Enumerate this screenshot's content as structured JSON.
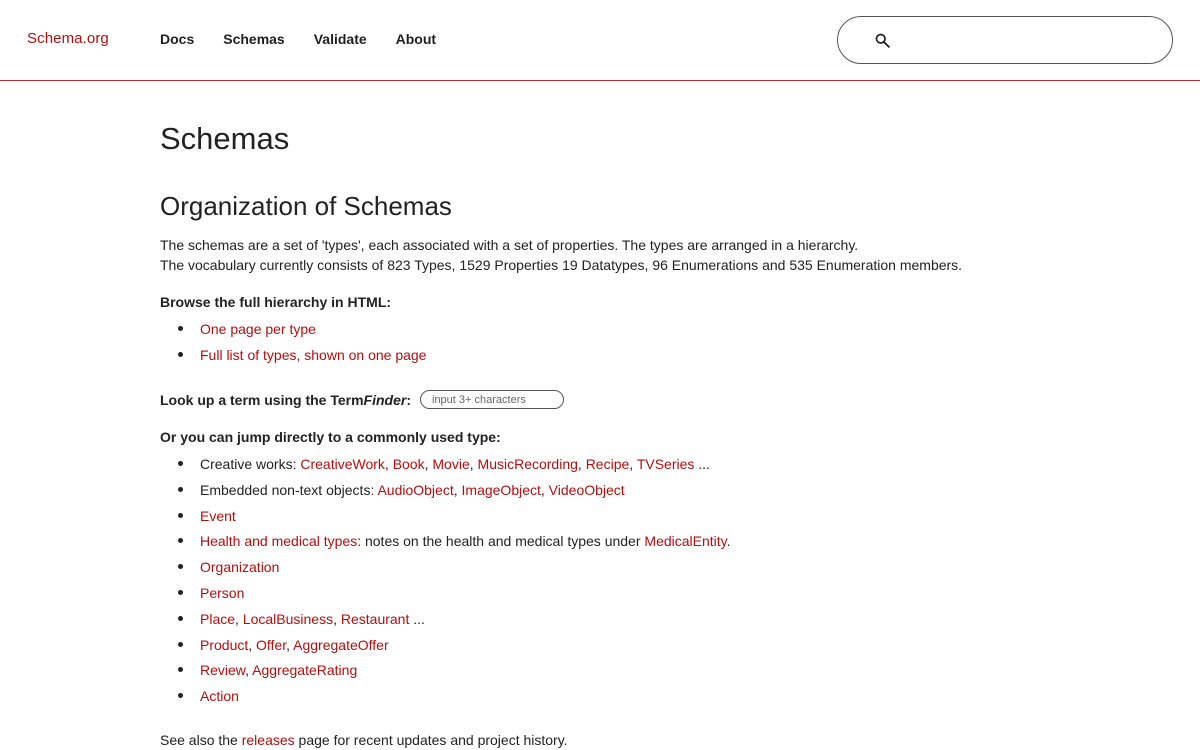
{
  "header": {
    "brand": "Schema.org",
    "nav": [
      "Docs",
      "Schemas",
      "Validate",
      "About"
    ],
    "search_placeholder": ""
  },
  "main": {
    "title": "Schemas",
    "section_title": "Organization of Schemas",
    "intro_line1": "The schemas are a set of 'types', each associated with a set of properties. The types are arranged in a hierarchy.",
    "intro_line2": "The vocabulary currently consists of 823 Types, 1529 Properties 19 Datatypes, 96 Enumerations and 535 Enumeration members.",
    "browse_heading": "Browse the full hierarchy in HTML:",
    "browse_links": [
      "One page per type",
      "Full list of types, shown on one page"
    ],
    "lookup_prefix": "Look up a term using the Term",
    "lookup_em": "Finder",
    "lookup_suffix": ":",
    "termfinder_placeholder": "input 3+ characters",
    "jump_heading": "Or you can jump directly to a commonly used type:",
    "types": {
      "creative": {
        "label": "Creative works: ",
        "links": [
          "CreativeWork",
          "Book",
          "Movie",
          "MusicRecording",
          "Recipe",
          "TVSeries"
        ],
        "tail": " ..."
      },
      "embedded": {
        "label": "Embedded non-text objects: ",
        "links": [
          "AudioObject",
          "ImageObject",
          "VideoObject"
        ]
      },
      "event": "Event",
      "health": {
        "link": "Health and medical types",
        "text": ": notes on the health and medical types under ",
        "link2": "MedicalEntity",
        "end": "."
      },
      "organization": "Organization",
      "person": "Person",
      "place": {
        "links": [
          "Place",
          "LocalBusiness",
          "Restaurant"
        ],
        "tail": " ..."
      },
      "product": {
        "links": [
          "Product",
          "Offer",
          "AggregateOffer"
        ]
      },
      "review": {
        "links": [
          "Review",
          "AggregateRating"
        ]
      },
      "action": "Action"
    },
    "footer_prefix": "See also the ",
    "footer_link": "releases",
    "footer_suffix": " page for recent updates and project history."
  },
  "colors": {
    "link": "#b00f0f",
    "header_border": "#b5302f",
    "text": "#1f1f1f"
  }
}
